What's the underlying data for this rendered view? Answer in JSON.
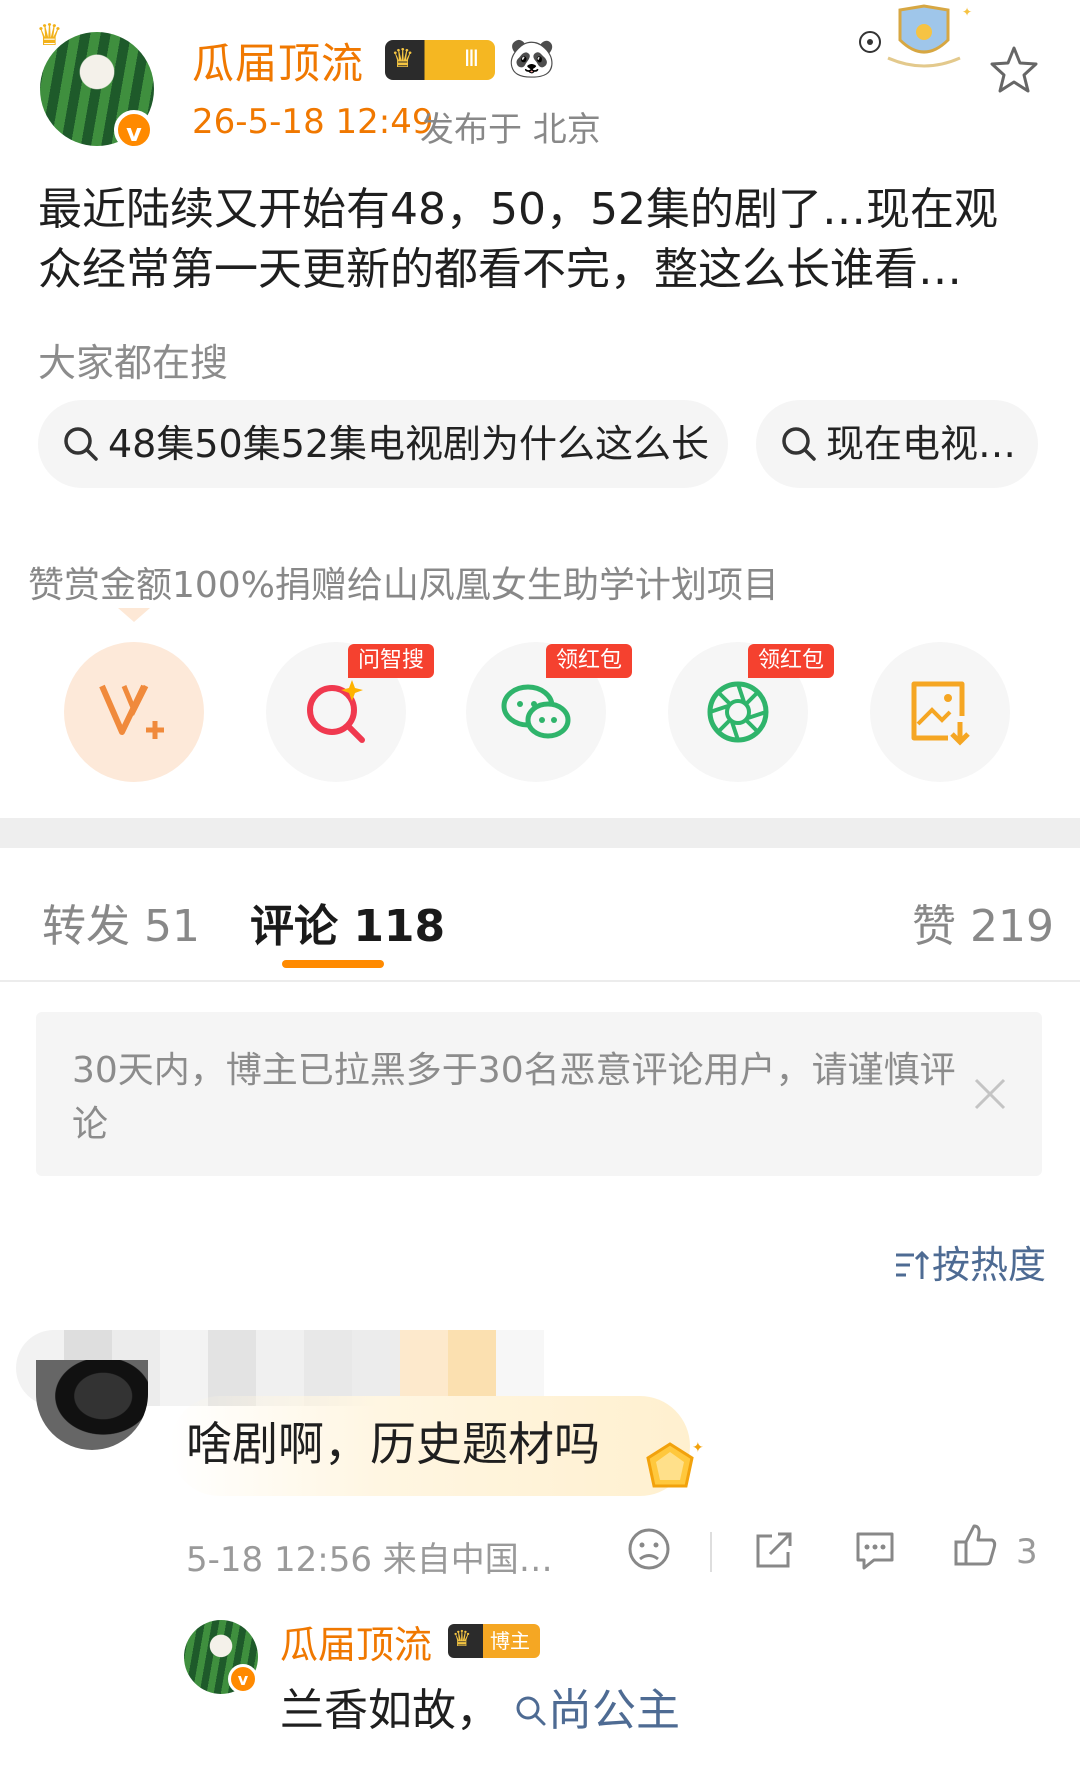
{
  "post": {
    "author": "瓜届顶流",
    "level_badge": "Ⅲ",
    "verified_mark": "v",
    "timestamp": "26-5-18 12:49",
    "location": "发布于 北京",
    "content": "最近陆续又开始有48，50，52集的剧了…现在观众经常第一天更新的都看不完，整这么长谁看…"
  },
  "hot_search": {
    "label": "大家都在搜",
    "chips": [
      "48集50集52集电视剧为什么这么长",
      "现在电视…"
    ]
  },
  "donate": {
    "text": "赞赏金额100%捐赠给山凤凰女生助学计划项目"
  },
  "actions": {
    "tag_search": "问智搜",
    "tag_redpacket_1": "领红包",
    "tag_redpacket_2": "领红包",
    "icons": [
      "v-plus-icon",
      "ai-search-icon",
      "wechat-icon",
      "moments-icon",
      "save-image-icon"
    ]
  },
  "tabs": {
    "repost": "转发 51",
    "comments": "评论 118",
    "likes": "赞 219"
  },
  "notice": {
    "text": "30天内，博主已拉黑多于30名恶意评论用户，请谨慎评论"
  },
  "sort": {
    "label": "按热度"
  },
  "comment": {
    "text": "啥剧啊，历史题材吗",
    "meta": "5-18 12:56 来自中国…",
    "like_count": "3"
  },
  "reply": {
    "author": "瓜届顶流",
    "badge": "博主",
    "text": "兰香如故，",
    "link_text": "尚公主"
  },
  "colors": {
    "accent_orange": "#f07800",
    "link_blue": "#4e6b93",
    "tag_red": "#f5412f"
  }
}
